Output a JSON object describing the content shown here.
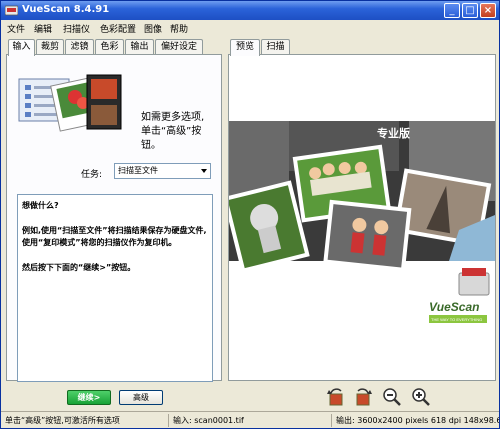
{
  "window": {
    "title": "VueScan 8.4.91"
  },
  "menu": [
    "文件",
    "编辑",
    "扫描仪",
    "色彩配置",
    "图像",
    "帮助"
  ],
  "left_tabs": [
    "输入",
    "裁剪",
    "滤镜",
    "色彩",
    "输出",
    "偏好设定"
  ],
  "right_tabs": [
    "预览",
    "扫描"
  ],
  "help": {
    "line1": "如需更多选项,",
    "line2": "单击“高级”按钮。"
  },
  "task": {
    "label": "任务:",
    "value": "扫描至文件"
  },
  "description": {
    "heading": "想做什么?",
    "paragraph1": "例如,使用“扫描至文件”将扫描结果保存为硬盘文件,使用“复印模式”将您的扫描仪作为复印机。",
    "paragraph2": "然后按下下面的“继续>”按钮。"
  },
  "preview": {
    "edition": "专业版",
    "logo_text": "VueScan",
    "logo_tagline": "THE WAY TO EVERYTHING"
  },
  "buttons": {
    "continue": "继续>",
    "advanced": "高级"
  },
  "toolbar_icons": [
    "rotate-left-icon",
    "rotate-right-icon",
    "zoom-out-icon",
    "zoom-in-icon"
  ],
  "status": {
    "hint": "单击“高级”按钮,可激活所有选项",
    "input": "输入: scan0001.tif",
    "output": "输出: 3600x2400 pixels 618 dpi 148x98.6 r"
  },
  "colors": {
    "titlebar": "#2b63d9",
    "primary_button": "#18a236",
    "window_bg": "#ece9d8"
  }
}
